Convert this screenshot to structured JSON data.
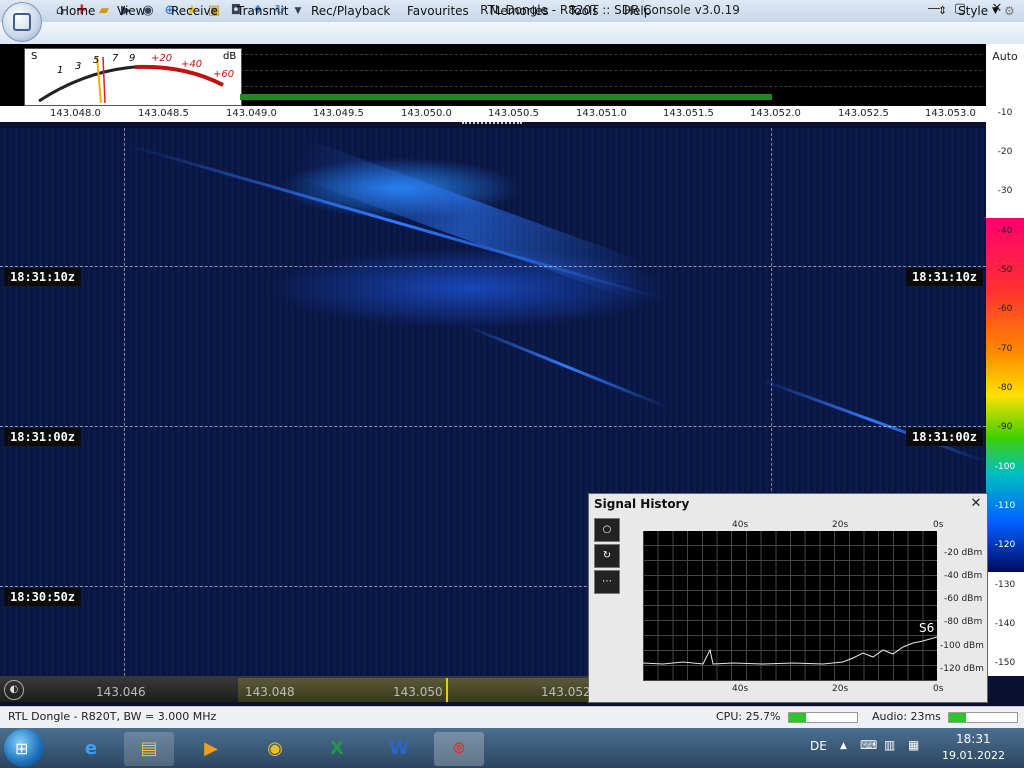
{
  "window": {
    "title": "RTL Dongle - R820T :: SDR Console v3.0.19"
  },
  "quick_access_icons": [
    "home-icon",
    "lifebuoy-icon",
    "folder-icon",
    "play-icon",
    "play-circle-icon",
    "stop-icon",
    "plus-icon",
    "star-icon",
    "lock-icon",
    "camera-icon",
    "drop-icon",
    "refresh-icon",
    "dropdown-icon"
  ],
  "menu": [
    "Home",
    "View",
    "Receive",
    "Transmit",
    "Rec/Playback",
    "Favourites",
    "Memories",
    "Tools",
    "Help"
  ],
  "style_label": "Style",
  "smeter": {
    "scale_labels": [
      "S",
      "1",
      "3",
      "5",
      "7",
      "9",
      "+20",
      "+40",
      "+60",
      "dB"
    ]
  },
  "spectrum_freqs": [
    "143.048.0",
    "143.048.5",
    "143.049.0",
    "143.049.5",
    "143.050.0",
    "143.050.5",
    "143.051.0",
    "143.051.5",
    "143.052.0",
    "143.052.5",
    "143.053.0"
  ],
  "auto_label": "Auto",
  "db_ticks": [
    "-10",
    "-20",
    "-30",
    "-40",
    "-50",
    "-60",
    "-70",
    "-80",
    "-90",
    "-100",
    "-110",
    "-120",
    "-130",
    "-140",
    "-150"
  ],
  "timestamps": [
    "18:31:10z",
    "18:31:00z",
    "18:30:50z"
  ],
  "signal_history": {
    "title": "Signal History",
    "top_axis": [
      "40s",
      "20s",
      "0s"
    ],
    "bottom_axis": [
      "40s",
      "20s",
      "0s"
    ],
    "y_labels": [
      "-20 dBm",
      "-40 dBm",
      "-60 dBm",
      "-80 dBm",
      "-100 dBm",
      "-120 dBm"
    ],
    "badge": "S6"
  },
  "freq_bar": [
    "143.046",
    "143.048",
    "143.050",
    "143.052"
  ],
  "status": {
    "device": "RTL Dongle - R820T, BW = 3.000 MHz",
    "cpu": "CPU: 25.7%",
    "cpu_fraction": 0.257,
    "audio": "Audio: 23ms",
    "audio_fraction": 0.25
  },
  "taskbar": {
    "lang": "DE",
    "time": "18:31",
    "date": "19.01.2022"
  }
}
